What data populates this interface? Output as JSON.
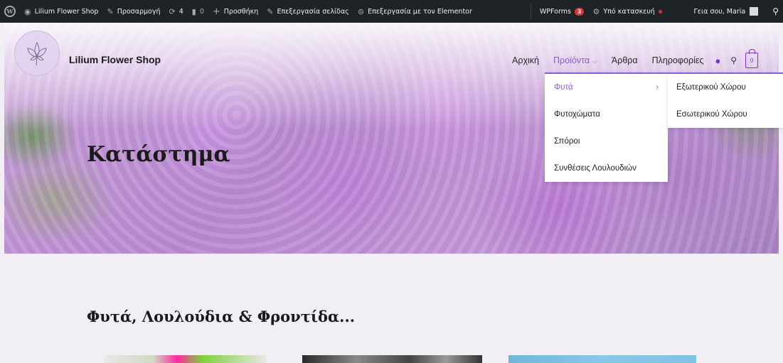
{
  "adminbar": {
    "site_name": "Lilium Flower Shop",
    "customize": "Προσαρμογή",
    "updates_count": "4",
    "comments_count": "0",
    "new": "Προσθήκη",
    "edit_page": "Επεξεργασία σελίδας",
    "edit_elementor": "Επεξεργασία με τον Elementor",
    "wpforms": "WPForms",
    "wpforms_count": "3",
    "maintenance": "Υπό κατασκευή",
    "greeting": "Γεια σου, Maria"
  },
  "header": {
    "site_title": "Lilium Flower Shop",
    "cart_count": "0"
  },
  "nav": {
    "items": [
      {
        "label": "Αρχική"
      },
      {
        "label": "Προϊόντα"
      },
      {
        "label": "Άρθρα"
      },
      {
        "label": "Πληροφορίες"
      }
    ]
  },
  "dropdown": {
    "items": [
      {
        "label": "Φυτά"
      },
      {
        "label": "Φυτοχώματα"
      },
      {
        "label": "Σπόροι"
      },
      {
        "label": "Συνθέσεις Λουλουδιών"
      }
    ],
    "submenu": [
      {
        "label": "Εξωτερικού Χώρου"
      },
      {
        "label": "Εσωτερικού Χώρου"
      }
    ]
  },
  "hero": {
    "title": "Κατάστημα"
  },
  "section": {
    "title": "Φυτά, Λουλούδια & Φροντίδα..."
  },
  "colors": {
    "accent": "#8b5cd6",
    "adminbar_bg": "#1d2327",
    "page_bg": "#f1eff3"
  }
}
